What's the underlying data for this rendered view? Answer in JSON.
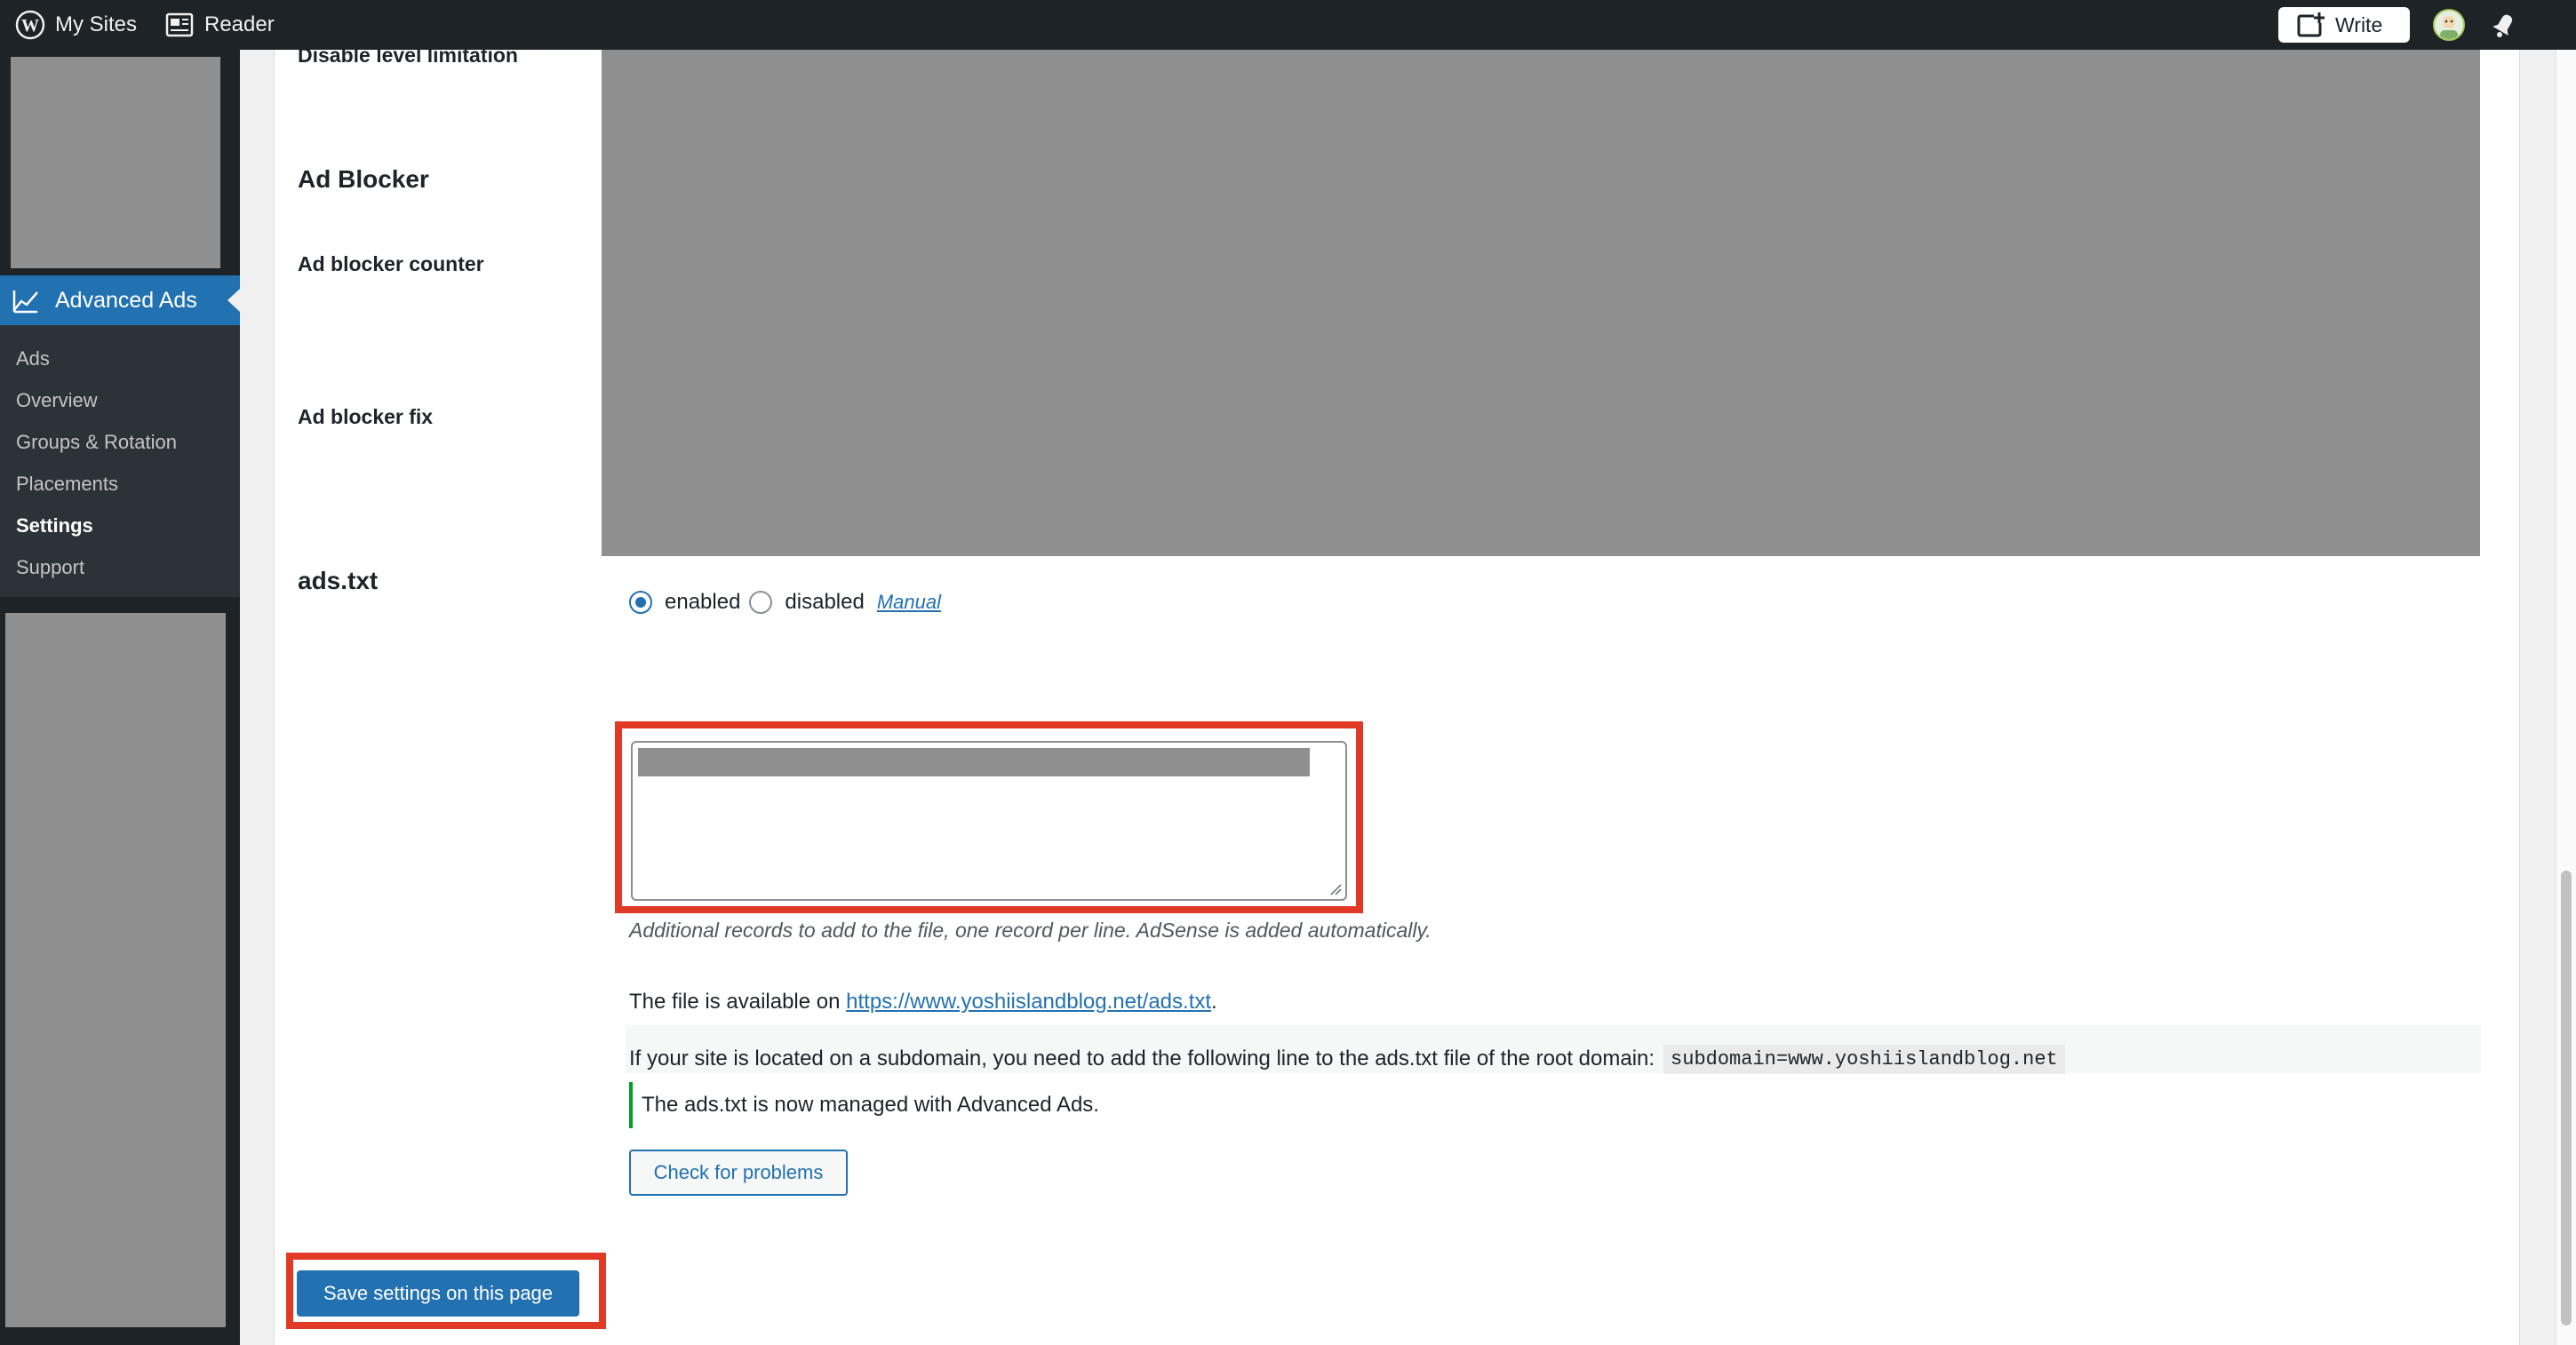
{
  "adminbar": {
    "my_sites": "My Sites",
    "reader": "Reader",
    "write": "Write"
  },
  "sidebar": {
    "current": "Advanced Ads",
    "items": [
      {
        "label": "Ads"
      },
      {
        "label": "Overview"
      },
      {
        "label": "Groups & Rotation"
      },
      {
        "label": "Placements"
      },
      {
        "label": "Settings",
        "active": true
      },
      {
        "label": "Support"
      }
    ]
  },
  "settings": {
    "disable_level": "Disable level limitation",
    "ad_blocker_heading": "Ad Blocker",
    "ad_blocker_counter": "Ad blocker counter",
    "ad_blocker_fix": "Ad blocker fix",
    "ads_txt_heading": "ads.txt",
    "radio_enabled": "enabled",
    "radio_disabled": "disabled",
    "manual_link": "Manual",
    "selected": "enabled",
    "textarea_description": "Additional records to add to the file, one record per line. AdSense is added automatically.",
    "file_available_prefix": "The file is available on",
    "file_url": "https://www.yoshiislandblog.net/ads.txt",
    "subdomain_text": "If your site is located on a subdomain, you need to add the following line to the ads.txt file of the root domain:",
    "subdomain_code": "subdomain=www.yoshiislandblog.net",
    "managed_notice": "The ads.txt is now managed with Advanced Ads.",
    "check_button": "Check for problems",
    "save_button": "Save settings on this page"
  },
  "colors": {
    "admin_bar": "#1d2327",
    "accent": "#2271b1",
    "highlight": "#e03a26",
    "redacted": "#8f8f8f",
    "notice_bar": "#00a32a"
  }
}
